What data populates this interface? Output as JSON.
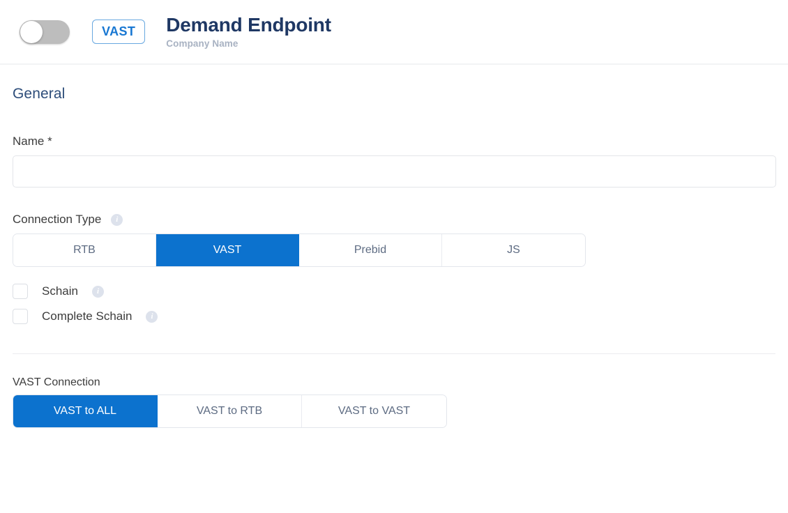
{
  "header": {
    "toggle": {
      "name": "enabled-toggle",
      "state": "off"
    },
    "type_badge": "VAST",
    "title": "Demand Endpoint",
    "subtitle": "Company Name"
  },
  "general": {
    "section_title": "General",
    "name_field": {
      "label": "Name *",
      "value": "",
      "placeholder": ""
    },
    "connection_type": {
      "label": "Connection Type",
      "info_icon": "info-icon",
      "options": [
        "RTB",
        "VAST",
        "Prebid",
        "JS"
      ],
      "selected": "VAST"
    },
    "checkboxes": [
      {
        "label": "Schain",
        "checked": false,
        "info_icon": "info-icon"
      },
      {
        "label": "Complete Schain",
        "checked": false,
        "info_icon": "info-icon"
      }
    ]
  },
  "vast_connection": {
    "label": "VAST Connection",
    "options": [
      "VAST to ALL",
      "VAST to RTB",
      "VAST to VAST"
    ],
    "selected": "VAST to ALL"
  },
  "colors": {
    "accent_blue": "#0c72ce",
    "title_navy": "#1f3864",
    "section_blue": "#2d4d7a",
    "subtitle_gray": "#a8b2c2",
    "border_gray": "#e3e6ec",
    "toggle_track": "#bdbdbd"
  }
}
